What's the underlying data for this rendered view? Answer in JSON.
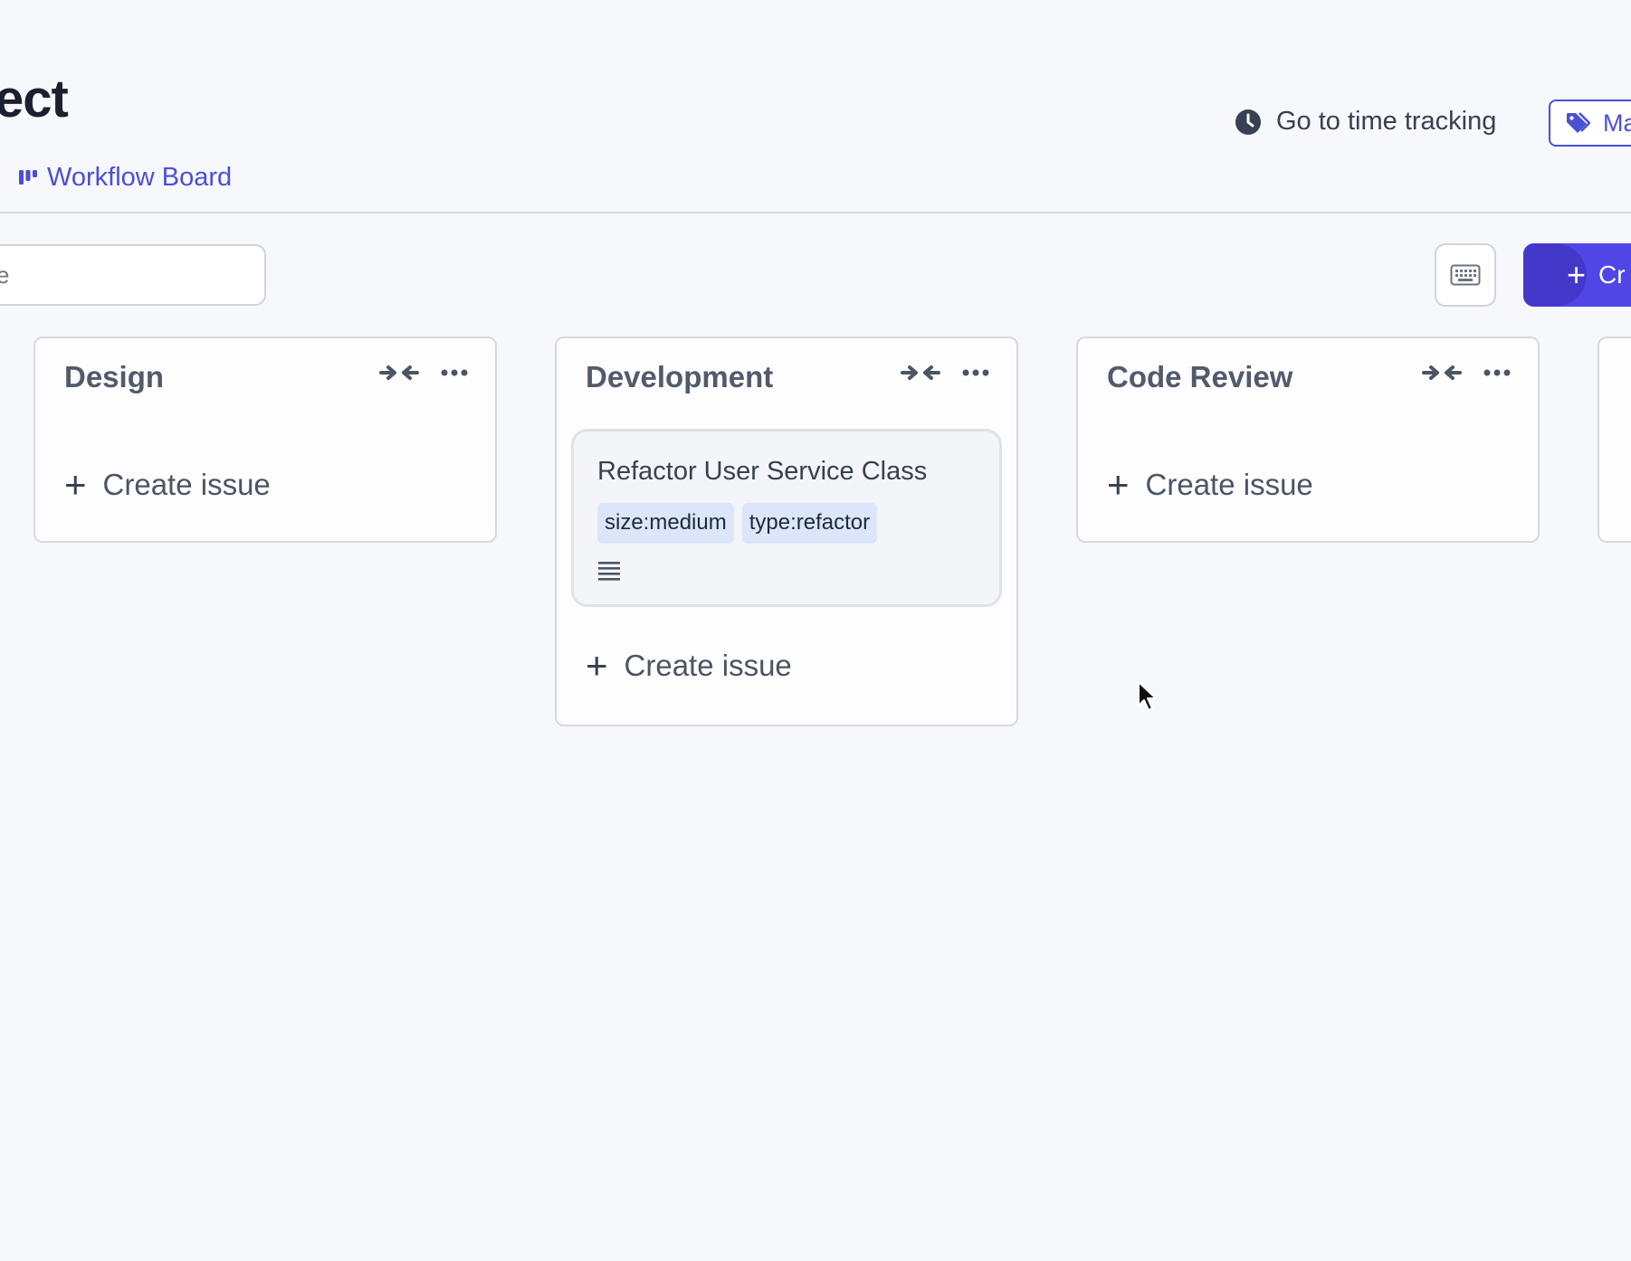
{
  "header": {
    "title": "ect",
    "board_link": "Workflow Board",
    "time_tracking": "Go to time tracking",
    "labels_button": "Ma"
  },
  "toolbar": {
    "search_placeholder": "e",
    "create_button": "Cr"
  },
  "columns": [
    {
      "name": "Design",
      "create_label": "Create issue"
    },
    {
      "name": "Development",
      "create_label": "Create issue",
      "cards": [
        {
          "title": "Refactor User Service Class",
          "tags": [
            "size:medium",
            "type:refactor"
          ]
        }
      ]
    },
    {
      "name": "Code Review",
      "create_label": "Create issue"
    }
  ],
  "colors": {
    "accent": "#4f46e5",
    "link": "#4b4fd6",
    "tag_bg": "#dbe6fb"
  }
}
